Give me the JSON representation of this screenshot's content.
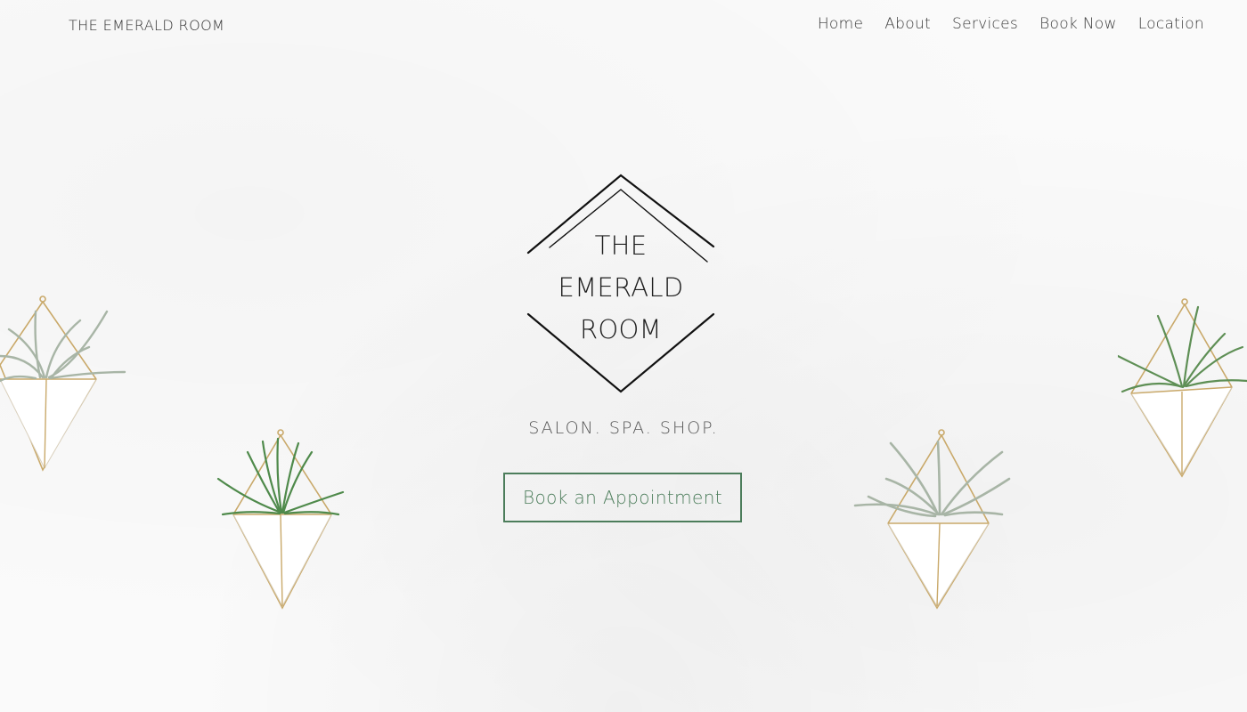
{
  "header": {
    "site_title": "THE EMERALD ROOM",
    "nav": [
      {
        "label": "Home"
      },
      {
        "label": "About"
      },
      {
        "label": "Services"
      },
      {
        "label": "Book Now"
      },
      {
        "label": "Location"
      }
    ]
  },
  "hero": {
    "logo_lines": [
      "THE",
      "EMERALD",
      "ROOM"
    ],
    "tagline": "SALON. SPA. SHOP.",
    "cta_label": "Book an Appointment"
  },
  "colors": {
    "accent": "#4c7d5b",
    "brass": "#c9a96a",
    "text": "#2b2b2b"
  },
  "decor": {
    "icon": "hanging-planter-icon",
    "count": 4
  }
}
